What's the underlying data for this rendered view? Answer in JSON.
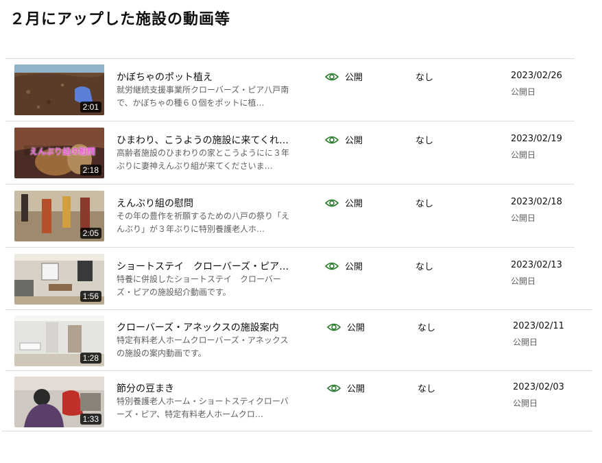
{
  "page": {
    "title": "２月にアップした施設の動画等"
  },
  "colors": {
    "eye_icon": "#2e7d32",
    "desc_text": "#606060",
    "divider": "#dcdcdc"
  },
  "videos": [
    {
      "title": "かぼちゃのポット植え",
      "description": "就労継続支援事業所クローバーズ・ピア八戸南で、かぼちゃの種６０個をポットに植…",
      "duration": "2:01",
      "visibility": "公開",
      "restrictions": "なし",
      "date": "2023/02/26",
      "date_label": "公開日",
      "thumb_caption": ""
    },
    {
      "title": "ひまわり、こうようの施設に来てくれ…",
      "description": "高齢者施設のひまわりの家とこうようにに３年ぶりに妻神えんぶり組が来てくださいま…",
      "duration": "2:18",
      "visibility": "公開",
      "restrictions": "なし",
      "date": "2023/02/19",
      "date_label": "公開日",
      "thumb_caption": "えんぶり組の慰問"
    },
    {
      "title": "えんぶり組の慰問",
      "description": "その年の豊作を祈願するための八戸の祭り「えんぶり」が３年ぶりに特別養護老人ホ…",
      "duration": "2:05",
      "visibility": "公開",
      "restrictions": "なし",
      "date": "2023/02/18",
      "date_label": "公開日",
      "thumb_caption": ""
    },
    {
      "title": "ショートステイ　クローバーズ・ピア…",
      "description": "特養に併設したショートステイ　クローバーズ・ピアの施設紹介動画です。",
      "duration": "1:56",
      "visibility": "公開",
      "restrictions": "なし",
      "date": "2023/02/13",
      "date_label": "公開日",
      "thumb_caption": ""
    },
    {
      "title": "クローバーズ・アネックスの施設案内",
      "description": "特定有料老人ホームクローバーズ・アネックスの施設の案内動画です。",
      "duration": "1:28",
      "visibility": "公開",
      "restrictions": "なし",
      "date": "2023/02/11",
      "date_label": "公開日",
      "thumb_caption": ""
    },
    {
      "title": "節分の豆まき",
      "description": "特別養護老人ホーム・ショートスティクローバーズ・ピア、特定有料老人ホームクロ…",
      "duration": "1:33",
      "visibility": "公開",
      "restrictions": "なし",
      "date": "2023/02/03",
      "date_label": "公開日",
      "thumb_caption": ""
    }
  ]
}
